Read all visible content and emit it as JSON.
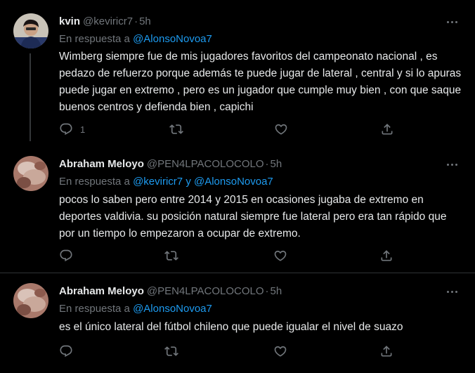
{
  "colors": {
    "background": "#000000",
    "text": "#e7e9ea",
    "muted": "#71767b",
    "mention": "#1d9bf0",
    "divider": "#2f3336"
  },
  "tweets": [
    {
      "name": "kvin",
      "handle": "@keviricr7",
      "time": "5h",
      "reply_prefix": "En respuesta a",
      "reply_to": "@AlonsoNovoa7",
      "text": "Wimberg siempre fue de mis jugadores favoritos del campeonato nacional , es pedazo de refuerzo porque además te puede jugar de lateral , central y si lo apuras puede jugar en extremo , pero es un jugador que cumple muy bien , con que saque buenos centros y defienda bien , capichi",
      "reply_count": "1"
    },
    {
      "name": "Abraham Meloyo",
      "handle": "@PEN4LPACOLOCOLO",
      "time": "5h",
      "reply_prefix": "En respuesta a",
      "reply_to": "@keviricr7 y @AlonsoNovoa7",
      "text": "pocos lo saben pero entre 2014 y 2015 en ocasiones jugaba de extremo en deportes valdivia. su posición natural siempre fue lateral pero era tan rápido que por un tiempo lo empezaron a ocupar de extremo.",
      "reply_count": ""
    },
    {
      "name": "Abraham Meloyo",
      "handle": "@PEN4LPACOLOCOLO",
      "time": "5h",
      "reply_prefix": "En respuesta a",
      "reply_to": "@AlonsoNovoa7",
      "text": "es el único lateral del fútbol chileno que puede igualar el nivel de suazo",
      "reply_count": ""
    }
  ],
  "icons": {
    "reply": "reply-icon",
    "retweet": "retweet-icon",
    "like": "heart-icon",
    "share": "share-icon",
    "more": "more-options-icon"
  }
}
